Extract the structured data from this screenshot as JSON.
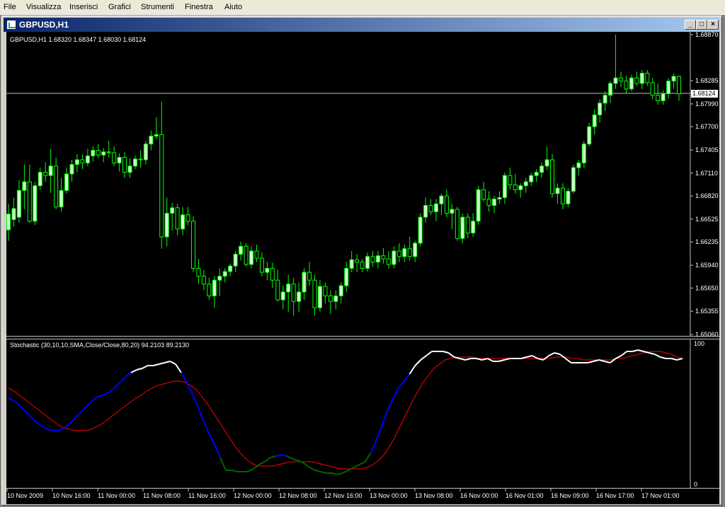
{
  "menu": [
    "File",
    "Visualizza",
    "Inserisci",
    "Grafici",
    "Strumenti",
    "Finestra",
    "Aiuto"
  ],
  "window": {
    "title": "GBPUSD,H1",
    "min": "_",
    "max": "□",
    "close": "×"
  },
  "main_chart": {
    "info": "GBPUSD,H1  1.68320 1.68347 1.68030 1.68124",
    "current_price": "1.68124",
    "price_labels": [
      "1.68870",
      "1.68285",
      "1.67990",
      "1.67700",
      "1.67405",
      "1.67110",
      "1.66820",
      "1.66525",
      "1.66235",
      "1.65940",
      "1.65650",
      "1.65355",
      "1.65060"
    ]
  },
  "indicator": {
    "info": "Stochastic (30,10,10,SMA,Close/Close,80,20) 94.2103 89.2130",
    "levels": [
      "100",
      "0"
    ]
  },
  "time_labels": [
    "10 Nov 2009",
    "10 Nov 16:00",
    "11 Nov 00:00",
    "11 Nov 08:00",
    "11 Nov 16:00",
    "12 Nov 00:00",
    "12 Nov 08:00",
    "12 Nov 16:00",
    "13 Nov 00:00",
    "13 Nov 08:00",
    "16 Nov 00:00",
    "16 Nov 01:00",
    "16 Nov 09:00",
    "16 Nov 17:00",
    "17 Nov 01:00"
  ],
  "colors": {
    "bull": "#ccffcc",
    "bear": "#000000",
    "wick": "#00ff00",
    "signal": "#ff0000",
    "main_line": "#ffffff",
    "low_segment": "#006400",
    "mid_segment": "#0000ff"
  },
  "chart_data": {
    "type": "candlestick",
    "ylim": [
      1.6506,
      1.6887
    ],
    "candles": [
      [
        1.6639,
        1.6672,
        1.6625,
        1.6659
      ],
      [
        1.6652,
        1.668,
        1.6643,
        1.6666
      ],
      [
        1.6655,
        1.6702,
        1.6648,
        1.6689
      ],
      [
        1.6689,
        1.6722,
        1.6665,
        1.67
      ],
      [
        1.67,
        1.6722,
        1.6648,
        1.665
      ],
      [
        1.665,
        1.67,
        1.6645,
        1.6695
      ],
      [
        1.6695,
        1.6718,
        1.669,
        1.6712
      ],
      [
        1.6712,
        1.6725,
        1.67,
        1.6708
      ],
      [
        1.6708,
        1.6742,
        1.6686,
        1.672
      ],
      [
        1.672,
        1.6731,
        1.6665,
        1.6668
      ],
      [
        1.6668,
        1.6705,
        1.6662,
        1.6689
      ],
      [
        1.6689,
        1.6718,
        1.6685,
        1.671
      ],
      [
        1.671,
        1.6728,
        1.67,
        1.6722
      ],
      [
        1.6722,
        1.6735,
        1.6712,
        1.6728
      ],
      [
        1.6728,
        1.6735,
        1.6716,
        1.6724
      ],
      [
        1.6724,
        1.6742,
        1.672,
        1.6733
      ],
      [
        1.6733,
        1.6745,
        1.6726,
        1.674
      ],
      [
        1.674,
        1.6748,
        1.673,
        1.6734
      ],
      [
        1.6734,
        1.6743,
        1.6725,
        1.6738
      ],
      [
        1.6738,
        1.6752,
        1.6731,
        1.6737
      ],
      [
        1.6737,
        1.6745,
        1.672,
        1.6724
      ],
      [
        1.6724,
        1.6736,
        1.6713,
        1.6731
      ],
      [
        1.6731,
        1.6738,
        1.6705,
        1.6712
      ],
      [
        1.6712,
        1.673,
        1.6705,
        1.672
      ],
      [
        1.672,
        1.6733,
        1.6716,
        1.6729
      ],
      [
        1.6729,
        1.674,
        1.6718,
        1.6728
      ],
      [
        1.6728,
        1.6752,
        1.6722,
        1.6748
      ],
      [
        1.6748,
        1.6765,
        1.674,
        1.6758
      ],
      [
        1.6758,
        1.6782,
        1.6754,
        1.676
      ],
      [
        1.676,
        1.6802,
        1.6615,
        1.663
      ],
      [
        1.663,
        1.668,
        1.6618,
        1.666
      ],
      [
        1.666,
        1.6673,
        1.6638,
        1.6667
      ],
      [
        1.6667,
        1.6672,
        1.6632,
        1.664
      ],
      [
        1.664,
        1.6668,
        1.6632,
        1.6658
      ],
      [
        1.6658,
        1.6668,
        1.6645,
        1.665
      ],
      [
        1.665,
        1.6656,
        1.6585,
        1.659
      ],
      [
        1.659,
        1.6602,
        1.657,
        1.658
      ],
      [
        1.658,
        1.6588,
        1.6562,
        1.657
      ],
      [
        1.657,
        1.6578,
        1.655,
        1.6555
      ],
      [
        1.6555,
        1.658,
        1.654,
        1.6575
      ],
      [
        1.6575,
        1.659,
        1.6555,
        1.658
      ],
      [
        1.658,
        1.659,
        1.6572,
        1.6586
      ],
      [
        1.6586,
        1.6596,
        1.658,
        1.6593
      ],
      [
        1.6593,
        1.6612,
        1.6585,
        1.6608
      ],
      [
        1.6608,
        1.6624,
        1.66,
        1.6618
      ],
      [
        1.6618,
        1.6622,
        1.6592,
        1.6595
      ],
      [
        1.6595,
        1.6618,
        1.659,
        1.6612
      ],
      [
        1.6612,
        1.662,
        1.6598,
        1.6603
      ],
      [
        1.6603,
        1.661,
        1.658,
        1.6585
      ],
      [
        1.6585,
        1.6598,
        1.6575,
        1.659
      ],
      [
        1.659,
        1.6597,
        1.6565,
        1.6575
      ],
      [
        1.6575,
        1.6588,
        1.6548,
        1.655
      ],
      [
        1.655,
        1.6568,
        1.6538,
        1.656
      ],
      [
        1.656,
        1.6582,
        1.6535,
        1.657
      ],
      [
        1.657,
        1.6578,
        1.653,
        1.6548
      ],
      [
        1.6548,
        1.6572,
        1.6535,
        1.656
      ],
      [
        1.656,
        1.659,
        1.655,
        1.6585
      ],
      [
        1.6585,
        1.6598,
        1.6568,
        1.6575
      ],
      [
        1.6575,
        1.6582,
        1.653,
        1.654
      ],
      [
        1.654,
        1.6575,
        1.6535,
        1.6567
      ],
      [
        1.6567,
        1.6572,
        1.6545,
        1.6555
      ],
      [
        1.6555,
        1.6562,
        1.6532,
        1.6548
      ],
      [
        1.6548,
        1.6562,
        1.6538,
        1.6555
      ],
      [
        1.6555,
        1.6572,
        1.6545,
        1.6568
      ],
      [
        1.6568,
        1.6598,
        1.656,
        1.659
      ],
      [
        1.659,
        1.6612,
        1.6585,
        1.6601
      ],
      [
        1.6601,
        1.6608,
        1.6585,
        1.6598
      ],
      [
        1.6598,
        1.6602,
        1.6585,
        1.659
      ],
      [
        1.659,
        1.661,
        1.6586,
        1.6605
      ],
      [
        1.6605,
        1.6612,
        1.6592,
        1.6598
      ],
      [
        1.6598,
        1.6612,
        1.659,
        1.6606
      ],
      [
        1.6606,
        1.6616,
        1.6596,
        1.6602
      ],
      [
        1.6602,
        1.6612,
        1.659,
        1.6595
      ],
      [
        1.6595,
        1.6618,
        1.659,
        1.6612
      ],
      [
        1.6612,
        1.6622,
        1.6598,
        1.6605
      ],
      [
        1.6605,
        1.662,
        1.6598,
        1.6615
      ],
      [
        1.6615,
        1.663,
        1.66,
        1.6605
      ],
      [
        1.6605,
        1.6625,
        1.6598,
        1.6622
      ],
      [
        1.6622,
        1.666,
        1.6618,
        1.6655
      ],
      [
        1.6655,
        1.668,
        1.6648,
        1.667
      ],
      [
        1.667,
        1.6678,
        1.6658,
        1.6662
      ],
      [
        1.6662,
        1.6678,
        1.665,
        1.6672
      ],
      [
        1.6672,
        1.6685,
        1.6658,
        1.6682
      ],
      [
        1.6682,
        1.669,
        1.6655,
        1.666
      ],
      [
        1.666,
        1.6672,
        1.664,
        1.6665
      ],
      [
        1.6665,
        1.6668,
        1.6625,
        1.6628
      ],
      [
        1.6628,
        1.666,
        1.6622,
        1.6655
      ],
      [
        1.6655,
        1.666,
        1.6628,
        1.6635
      ],
      [
        1.6635,
        1.666,
        1.663,
        1.665
      ],
      [
        1.665,
        1.6695,
        1.6645,
        1.669
      ],
      [
        1.669,
        1.67,
        1.6675,
        1.6678
      ],
      [
        1.6678,
        1.6688,
        1.6662,
        1.667
      ],
      [
        1.667,
        1.6682,
        1.666,
        1.6678
      ],
      [
        1.6678,
        1.6688,
        1.6672,
        1.668
      ],
      [
        1.668,
        1.6712,
        1.6672,
        1.6708
      ],
      [
        1.6708,
        1.6718,
        1.669,
        1.6696
      ],
      [
        1.6696,
        1.671,
        1.6685,
        1.669
      ],
      [
        1.669,
        1.6698,
        1.668,
        1.6695
      ],
      [
        1.6695,
        1.6705,
        1.6686,
        1.67
      ],
      [
        1.67,
        1.6712,
        1.6695,
        1.6708
      ],
      [
        1.6708,
        1.6716,
        1.67,
        1.6712
      ],
      [
        1.6712,
        1.6725,
        1.6705,
        1.672
      ],
      [
        1.672,
        1.6745,
        1.6715,
        1.6728
      ],
      [
        1.6728,
        1.6735,
        1.668,
        1.6685
      ],
      [
        1.6685,
        1.6698,
        1.6672,
        1.6692
      ],
      [
        1.6692,
        1.6698,
        1.6665,
        1.6672
      ],
      [
        1.6672,
        1.6692,
        1.6668,
        1.6688
      ],
      [
        1.6688,
        1.6722,
        1.6685,
        1.6718
      ],
      [
        1.6718,
        1.6728,
        1.6708,
        1.6724
      ],
      [
        1.6724,
        1.6752,
        1.6718,
        1.6748
      ],
      [
        1.6748,
        1.6775,
        1.6745,
        1.677
      ],
      [
        1.677,
        1.6792,
        1.676,
        1.6785
      ],
      [
        1.6785,
        1.6805,
        1.6775,
        1.68
      ],
      [
        1.68,
        1.6815,
        1.679,
        1.681
      ],
      [
        1.681,
        1.6828,
        1.68,
        1.6825
      ],
      [
        1.6825,
        1.6887,
        1.6818,
        1.6832
      ],
      [
        1.6832,
        1.684,
        1.682,
        1.6828
      ],
      [
        1.6828,
        1.6835,
        1.6812,
        1.6818
      ],
      [
        1.6818,
        1.6836,
        1.6815,
        1.6832
      ],
      [
        1.6832,
        1.684,
        1.6822,
        1.6825
      ],
      [
        1.6825,
        1.6842,
        1.6818,
        1.6838
      ],
      [
        1.6838,
        1.6842,
        1.6822,
        1.6826
      ],
      [
        1.6826,
        1.6832,
        1.6805,
        1.681
      ],
      [
        1.681,
        1.6825,
        1.6798,
        1.6803
      ],
      [
        1.6803,
        1.6816,
        1.6798,
        1.6812
      ],
      [
        1.6812,
        1.6832,
        1.6806,
        1.6828
      ],
      [
        1.6828,
        1.6838,
        1.6818,
        1.6834
      ],
      [
        1.6834,
        1.6835,
        1.6803,
        1.6812
      ]
    ],
    "stochastic": {
      "main": [
        61,
        59,
        56,
        52,
        48,
        44,
        41,
        39,
        38,
        38,
        40,
        43,
        47,
        51,
        55,
        59,
        62,
        63,
        65,
        68,
        72,
        76,
        79,
        81,
        82,
        84,
        84,
        85,
        86,
        87,
        85,
        79,
        72,
        64,
        55,
        45,
        36,
        28,
        19,
        10,
        10,
        9,
        9,
        9,
        11,
        14,
        16,
        19,
        20,
        21,
        20,
        18,
        17,
        15,
        12,
        10,
        9,
        8,
        8,
        7,
        8,
        10,
        12,
        14,
        16,
        22,
        31,
        41,
        52,
        60,
        68,
        73,
        78,
        84,
        88,
        91,
        94,
        94,
        94,
        93,
        90,
        89,
        88,
        89,
        89,
        88,
        89,
        87,
        87,
        88,
        89,
        89,
        89,
        90,
        91,
        89,
        88,
        91,
        93,
        92,
        89,
        86,
        86,
        86,
        86,
        87,
        88,
        87,
        86,
        89,
        91,
        94,
        94,
        95,
        94,
        93,
        92,
        90,
        89,
        89,
        88,
        89
      ],
      "signal": [
        68,
        66,
        63,
        60,
        57,
        54,
        51,
        48,
        45,
        42,
        40,
        39,
        38,
        38,
        38,
        39,
        41,
        43,
        46,
        49,
        52,
        55,
        58,
        61,
        63,
        66,
        68,
        70,
        71,
        72,
        73,
        73,
        72,
        70,
        67,
        62,
        57,
        51,
        45,
        39,
        33,
        27,
        22,
        18,
        15,
        13,
        13,
        13,
        13,
        14,
        15,
        16,
        16,
        16,
        16,
        16,
        15,
        14,
        13,
        12,
        11,
        11,
        11,
        11,
        11,
        12,
        14,
        17,
        21,
        27,
        34,
        42,
        50,
        58,
        65,
        72,
        77,
        82,
        85,
        88,
        89,
        90,
        90,
        90,
        90,
        89,
        89,
        89,
        89,
        89,
        89,
        89,
        89,
        89,
        89,
        89,
        89,
        89,
        89,
        90,
        90,
        90,
        89,
        89,
        88,
        88,
        88,
        88,
        88,
        88,
        89,
        89,
        90,
        91,
        92,
        93,
        94,
        94,
        94,
        93,
        92,
        90,
        89
      ]
    }
  }
}
